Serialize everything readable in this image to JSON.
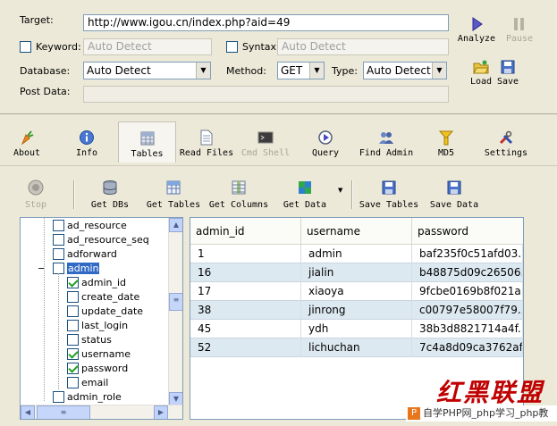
{
  "form": {
    "target_label": "Target:",
    "target_value": "http://www.igou.cn/index.php?aid=49",
    "keyword_label": "Keyword:",
    "keyword_placeholder": "Auto Detect",
    "syntax_label": "Syntax:",
    "syntax_placeholder": "Auto Detect",
    "database_label": "Database:",
    "database_value": "Auto Detect",
    "method_label": "Method:",
    "method_value": "GET",
    "type_label": "Type:",
    "type_value": "Auto Detect",
    "postdata_label": "Post Data:"
  },
  "side_tools": {
    "analyze": "Analyze",
    "pause": "Pause",
    "load": "Load",
    "save": "Save"
  },
  "nav": [
    {
      "label": "About",
      "icon": "carrot-icon"
    },
    {
      "label": "Info",
      "icon": "info-icon"
    },
    {
      "label": "Tables",
      "icon": "table-icon"
    },
    {
      "label": "Read Files",
      "icon": "file-icon"
    },
    {
      "label": "Cmd Shell",
      "icon": "terminal-icon"
    },
    {
      "label": "Query",
      "icon": "query-icon"
    },
    {
      "label": "Find Admin",
      "icon": "users-icon"
    },
    {
      "label": "MD5",
      "icon": "md5-icon"
    },
    {
      "label": "Settings",
      "icon": "settings-icon"
    }
  ],
  "subtoolbar": {
    "stop": "Stop",
    "get_dbs": "Get DBs",
    "get_tables": "Get Tables",
    "get_columns": "Get Columns",
    "get_data": "Get Data",
    "save_tables": "Save Tables",
    "save_data": "Save Data"
  },
  "tree": {
    "items": [
      {
        "label": "ad_resource",
        "checked": false
      },
      {
        "label": "ad_resource_seq",
        "checked": false
      },
      {
        "label": "adforward",
        "checked": false
      },
      {
        "label": "admin",
        "checked": false,
        "selected": true,
        "expand": "−"
      },
      {
        "label": "admin_id",
        "checked": true
      },
      {
        "label": "create_date",
        "checked": false
      },
      {
        "label": "update_date",
        "checked": false
      },
      {
        "label": "last_login",
        "checked": false
      },
      {
        "label": "status",
        "checked": false
      },
      {
        "label": "username",
        "checked": true
      },
      {
        "label": "password",
        "checked": true
      },
      {
        "label": "email",
        "checked": false
      },
      {
        "label": "admin_role",
        "checked": false
      }
    ]
  },
  "grid": {
    "columns": [
      "admin_id",
      "username",
      "password"
    ],
    "rows": [
      [
        "1",
        "admin",
        "baf235f0c51afd03..."
      ],
      [
        "16",
        "jialin",
        "b48875d09c26506..."
      ],
      [
        "17",
        "xiaoya",
        "9fcbe0169b8f021a..."
      ],
      [
        "38",
        "jinrong",
        "c00797e58007f79..."
      ],
      [
        "45",
        "ydh",
        "38b3d8821714a4f..."
      ],
      [
        "52",
        "lichuchan",
        "7c4a8d09ca3762af..."
      ]
    ]
  },
  "watermark": {
    "title": "红黑联盟",
    "logo_letter": "P",
    "caption": "自学PHP网_php学习_php教"
  },
  "colors": {
    "window_bg": "#ece9d8",
    "selection": "#316ac5",
    "alt_row": "#dde9f1",
    "check": "#21a121",
    "watermark_red": "#c00000"
  }
}
